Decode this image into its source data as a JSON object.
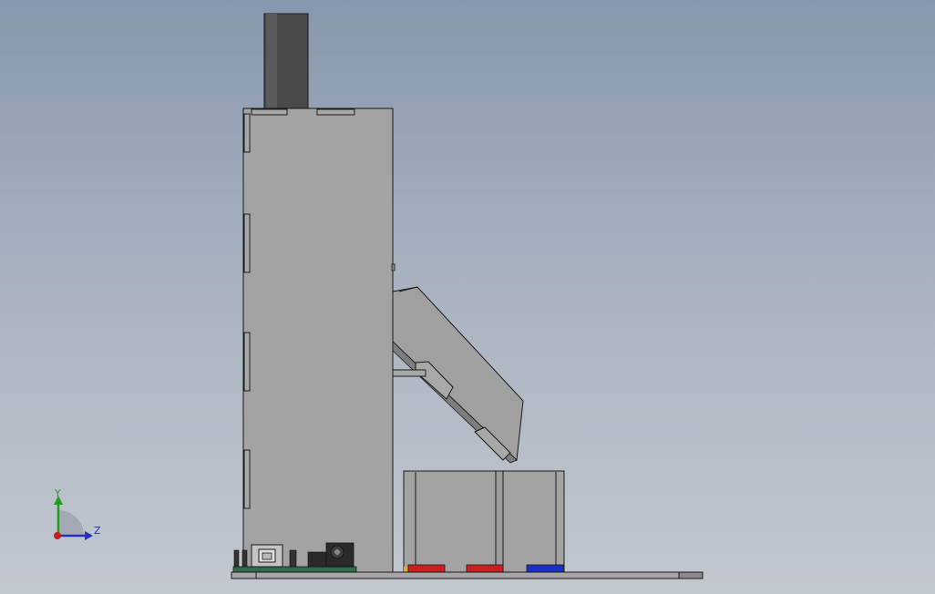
{
  "viewport": {
    "background_top": "#8797ad",
    "background_bottom": "#c3c8cf"
  },
  "model": {
    "body_color": "#a3a3a3",
    "edge_color": "#1a1a1a",
    "pcb_color": "#2f6b4a",
    "buttons": [
      {
        "color": "#cc2020"
      },
      {
        "color": "#cc2020"
      },
      {
        "color": "#1a2fc8"
      }
    ]
  },
  "triad": {
    "y_label": "Y",
    "z_label": "Z",
    "y_color": "#1f9e1f",
    "z_color": "#2030c0",
    "origin_color": "#c02020"
  }
}
